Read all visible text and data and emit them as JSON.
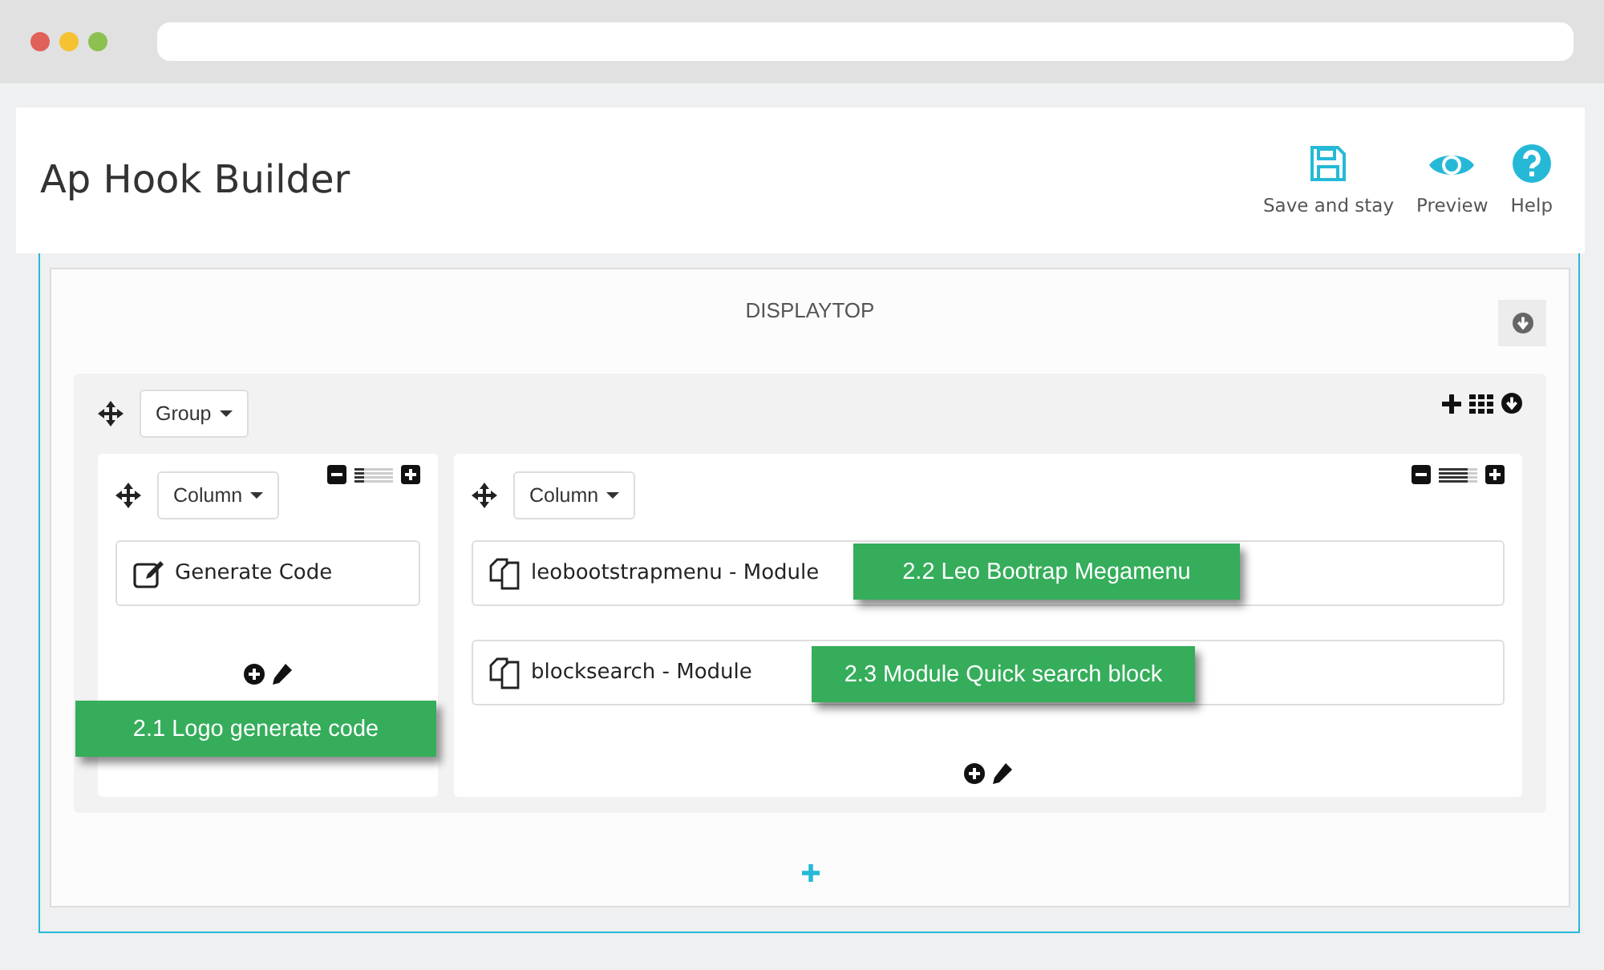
{
  "browser": {
    "dots": [
      {
        "color": "#e0605a"
      },
      {
        "color": "#f5c232"
      },
      {
        "color": "#8cc152"
      }
    ]
  },
  "header": {
    "title": "Ap Hook Builder",
    "toolbar": [
      {
        "label": "Save and stay",
        "kind": "save"
      },
      {
        "label": "Preview",
        "kind": "preview"
      },
      {
        "label": "Help",
        "kind": "help"
      }
    ]
  },
  "hook": {
    "name": "DISPLAYTOP",
    "group": {
      "button": "Group",
      "columns": [
        {
          "button": "Column",
          "level": 0.25,
          "modules": [
            {
              "label": "Generate Code",
              "kind": "code"
            }
          ]
        },
        {
          "button": "Column",
          "level": 0.75,
          "modules": [
            {
              "label": "leobootstrapmenu - Module",
              "kind": "module"
            },
            {
              "label": "blocksearch - Module",
              "kind": "module"
            }
          ]
        }
      ]
    }
  },
  "callouts": [
    "2.1 Logo generate code",
    "2.2 Leo Bootrap Megamenu",
    "2.3 Module Quick search block"
  ]
}
